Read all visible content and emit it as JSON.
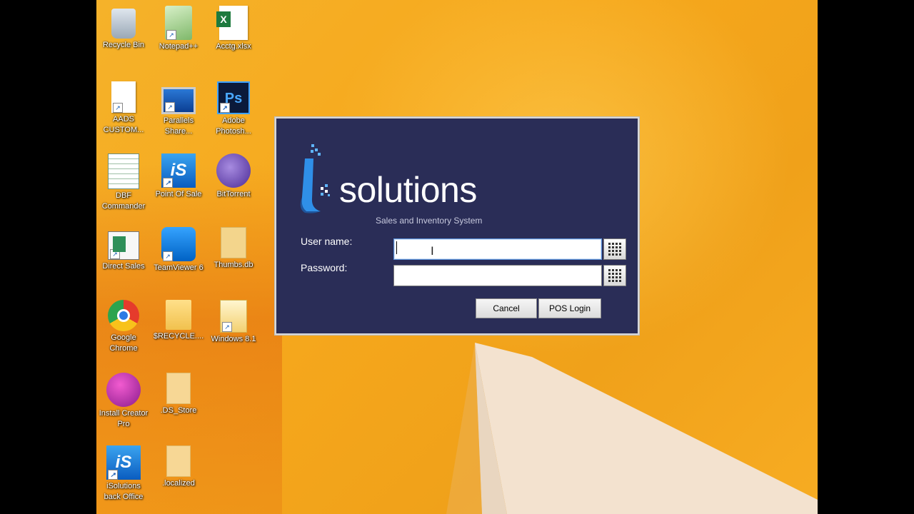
{
  "desktop": {
    "icons": [
      {
        "label": "Recycle Bin",
        "icon": "recycle-bin-icon"
      },
      {
        "label": "Notepad++",
        "icon": "notepad-plus-plus-icon"
      },
      {
        "label": "Acctg.xlsx",
        "icon": "excel-file-icon"
      },
      {
        "label": "AADS CUSTOM...",
        "icon": "document-icon"
      },
      {
        "label": "Parallels Share...",
        "icon": "parallels-share-icon"
      },
      {
        "label": "Adobe Photosh...",
        "icon": "photoshop-icon"
      },
      {
        "label": "DBF Commander",
        "icon": "dbf-commander-icon"
      },
      {
        "label": "Point Of Sale",
        "icon": "isolutions-pos-icon"
      },
      {
        "label": "BitTorrent",
        "icon": "bittorrent-icon"
      },
      {
        "label": "Direct Sales",
        "icon": "direct-sales-icon"
      },
      {
        "label": "TeamViewer 6",
        "icon": "teamviewer-icon"
      },
      {
        "label": "Thumbs.db",
        "icon": "system-file-icon"
      },
      {
        "label": "Google Chrome",
        "icon": "chrome-icon"
      },
      {
        "label": "$RECYCLE....",
        "icon": "folder-icon"
      },
      {
        "label": "Windows 8.1",
        "icon": "folder-zip-icon"
      },
      {
        "label": "Install Creator Pro",
        "icon": "install-creator-icon"
      },
      {
        "label": ".DS_Store",
        "icon": "file-icon"
      },
      {
        "label": "iSolutions back Office",
        "icon": "isolutions-backoffice-icon"
      },
      {
        "label": ".localized",
        "icon": "file-icon"
      }
    ]
  },
  "dialog": {
    "logo_text": "solutions",
    "logo_subtitle": "Sales and Inventory System",
    "username_label": "User name:",
    "username_value": "",
    "password_label": "Password:",
    "password_value": "",
    "cancel_label": "Cancel",
    "login_label": "POS Login"
  },
  "colors": {
    "dialog_background": "#2a2d57",
    "desktop_accent": "#f5a81f",
    "logo_blue": "#2f8fe8"
  }
}
